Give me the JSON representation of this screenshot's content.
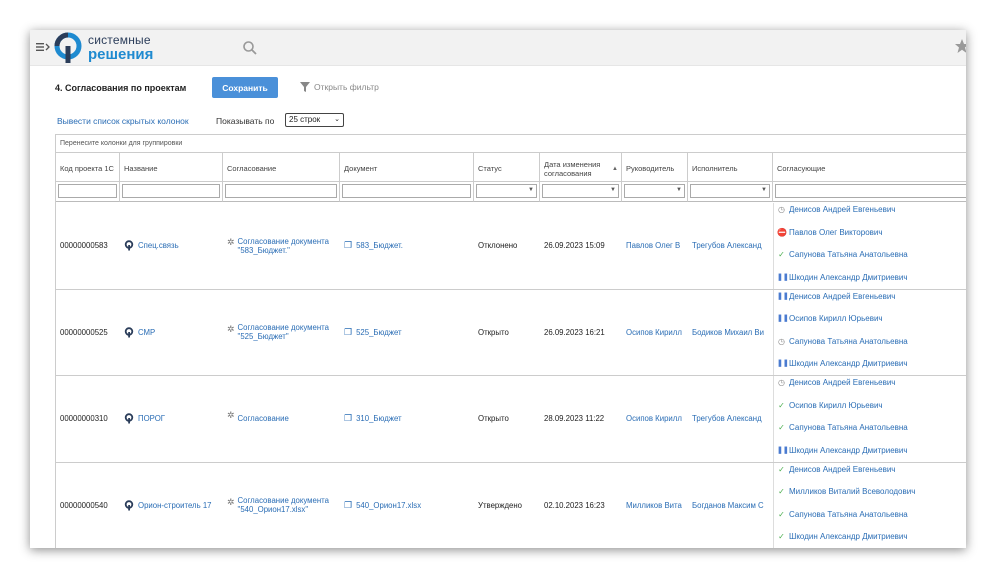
{
  "brand": {
    "line1": "системные",
    "line2": "решения"
  },
  "page": {
    "title": "4. Согласования по проектам",
    "save_label": "Сохранить",
    "filter_label": "Открыть фильтр"
  },
  "controls": {
    "hidden_cols_link": "Вывести список скрытых колонок",
    "show_by_label": "Показывать по",
    "page_size": "25 строк"
  },
  "grid": {
    "group_hint": "Перенесите колонки для группировки",
    "columns": [
      "Код проекта 1С",
      "Название",
      "Согласование",
      "Документ",
      "Статус",
      "Дата изменения согласования",
      "Руководитель",
      "Исполнитель",
      "Согласующие"
    ],
    "rows": [
      {
        "code": "00000000583",
        "name": "Спец.связь",
        "approval": "Согласование документа \"583_Бюджет.\"",
        "document": "583_Бюджет.",
        "status": "Отклонено",
        "date": "26.09.2023 15:09",
        "manager": "Павлов Олег В",
        "executor": "Трегубов Александ",
        "approvers": [
          {
            "icon": "wait",
            "name": "Денисов Андрей Евгеньевич"
          },
          {
            "icon": "stop",
            "name": "Павлов Олег Викторович"
          },
          {
            "icon": "ok",
            "name": "Сапунова Татьяна Анатольевна"
          },
          {
            "icon": "pause",
            "name": "Шкодин Александр Дмитриевич"
          }
        ]
      },
      {
        "code": "00000000525",
        "name": "СМР",
        "approval": "Согласование документа \"525_Бюджет\"",
        "document": "525_Бюджет",
        "status": "Открыто",
        "date": "26.09.2023 16:21",
        "manager": "Осипов Кирилл",
        "executor": "Бодиков Михаил Ви",
        "approvers": [
          {
            "icon": "pause",
            "name": "Денисов Андрей Евгеньевич"
          },
          {
            "icon": "pause",
            "name": "Осипов Кирилл Юрьевич"
          },
          {
            "icon": "wait",
            "name": "Сапунова Татьяна Анатольевна"
          },
          {
            "icon": "pause",
            "name": "Шкодин Александр Дмитриевич"
          }
        ]
      },
      {
        "code": "00000000310",
        "name": "ПОРОГ",
        "approval": "Согласование",
        "document": "310_Бюджет",
        "status": "Открыто",
        "date": "28.09.2023 11:22",
        "manager": "Осипов Кирилл",
        "executor": "Трегубов Александ",
        "approvers": [
          {
            "icon": "wait",
            "name": "Денисов Андрей Евгеньевич"
          },
          {
            "icon": "ok",
            "name": "Осипов Кирилл Юрьевич"
          },
          {
            "icon": "ok",
            "name": "Сапунова Татьяна Анатольевна"
          },
          {
            "icon": "pause",
            "name": "Шкодин Александр Дмитриевич"
          }
        ]
      },
      {
        "code": "00000000540",
        "name": "Орион-строитель 17",
        "approval": "Согласование документа \"540_Орион17.xlsx\"",
        "document": "540_Орион17.xlsx",
        "status": "Утверждено",
        "date": "02.10.2023 16:23",
        "manager": "Милликов Вита",
        "executor": "Богданов Максим С",
        "approvers": [
          {
            "icon": "ok",
            "name": "Денисов Андрей Евгеньевич"
          },
          {
            "icon": "ok",
            "name": "Милликов Виталий Всеволодович"
          },
          {
            "icon": "ok",
            "name": "Сапунова Татьяна Анатольевна"
          },
          {
            "icon": "ok",
            "name": "Шкодин Александр Дмитриевич"
          }
        ]
      }
    ]
  }
}
